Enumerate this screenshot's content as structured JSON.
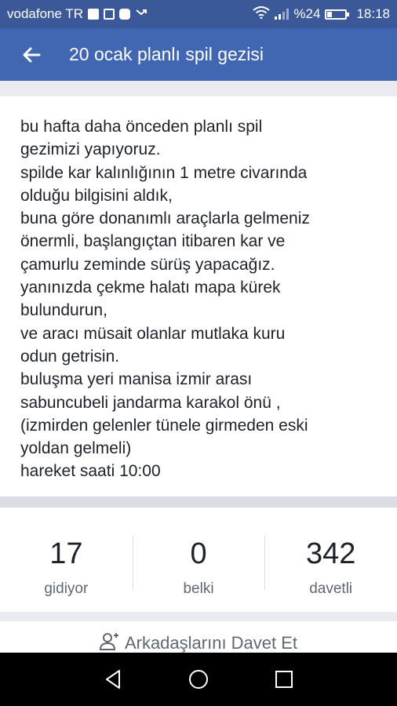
{
  "status_bar": {
    "carrier": "vodafone TR",
    "battery_text": "%24",
    "battery_level": 0.24,
    "time": "18:18"
  },
  "app_bar": {
    "title": "20 ocak planlı spil gezisi"
  },
  "event": {
    "description_lines": [
      "bu hafta daha önceden planlı spil",
      "gezimizi yapıyoruz.",
      "spilde kar kalınlığının 1 metre civarında",
      "olduğu bilgisini aldık,",
      "buna göre donanımlı araçlarla gelmeniz",
      "önermli, başlangıçtan itibaren kar ve",
      "çamurlu zeminde sürüş yapacağız.",
      "yanınızda çekme halatı mapa kürek",
      "bulundurun,",
      "ve aracı müsait olanlar mutlaka kuru",
      "odun getrisin.",
      "buluşma yeri manisa izmir arası",
      "sabuncubeli jandarma karakol önü ,",
      "(izmirden gelenler tünele girmeden eski",
      "yoldan gelmeli)",
      "hareket saati 10:00"
    ]
  },
  "stats": {
    "going": {
      "count": "17",
      "label": "gidiyor"
    },
    "maybe": {
      "count": "0",
      "label": "belki"
    },
    "invited": {
      "count": "342",
      "label": "davetli"
    }
  },
  "invite": {
    "label": "Arkadaşlarını Davet Et"
  },
  "icons": {
    "back": "arrow-left-icon",
    "invite": "add-person-icon",
    "nav_back": "triangle-back-icon",
    "nav_home": "circle-home-icon",
    "nav_recent": "square-recent-icon"
  }
}
